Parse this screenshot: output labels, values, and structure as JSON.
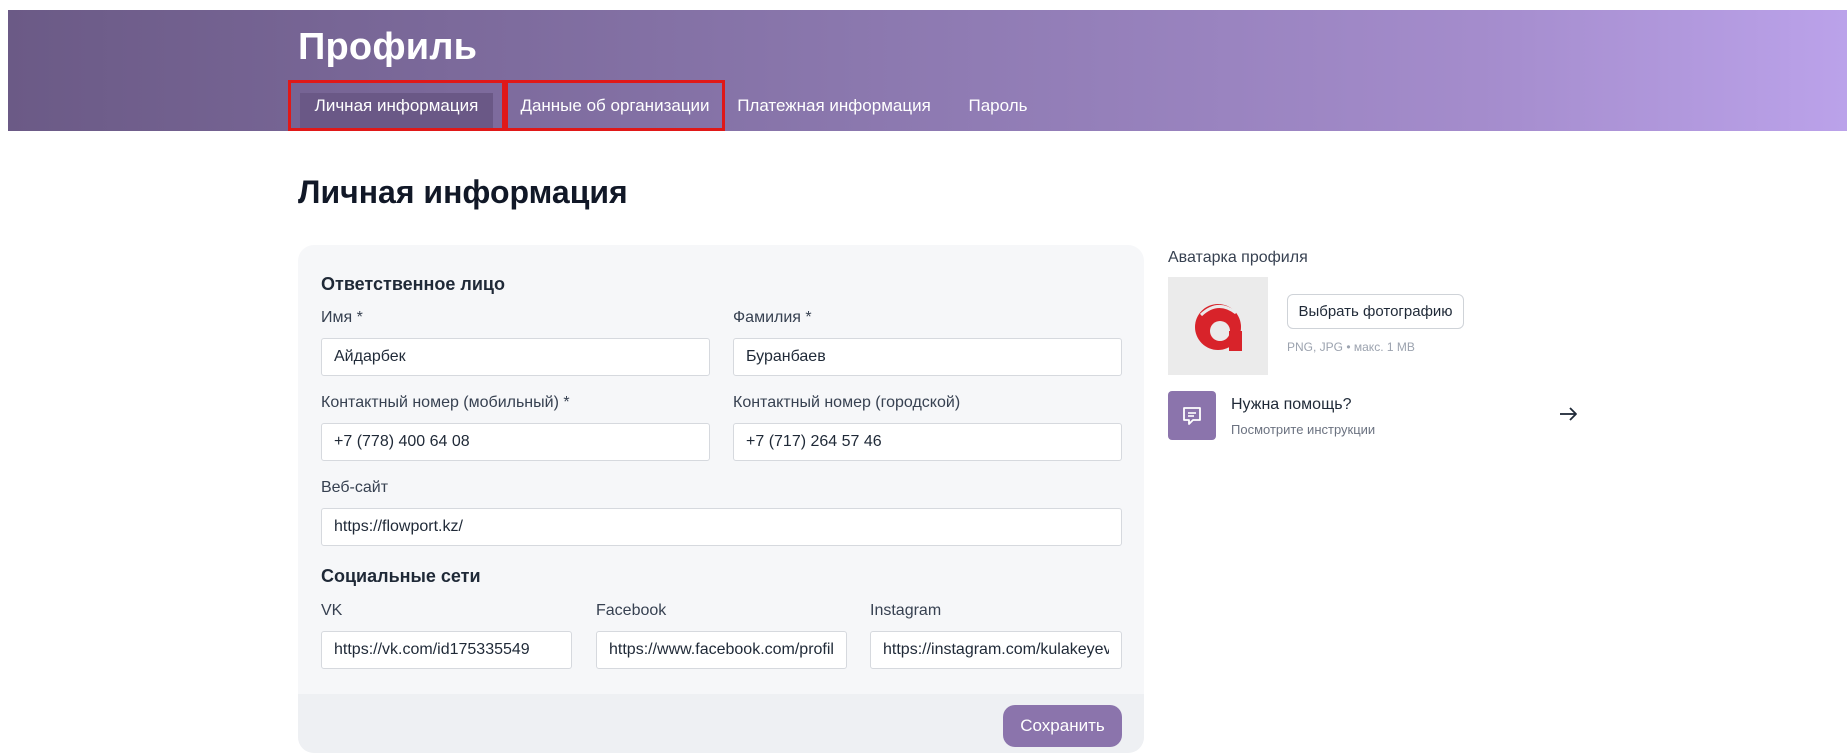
{
  "header": {
    "title": "Профиль",
    "tabs": [
      {
        "label": "Личная информация",
        "active": true
      },
      {
        "label": "Данные об организации",
        "active": false
      },
      {
        "label": "Платежная информация",
        "active": false
      },
      {
        "label": "Пароль",
        "active": false
      }
    ]
  },
  "main": {
    "section_title": "Личная информация",
    "responsible": {
      "title": "Ответственное лицо",
      "first_name": {
        "label": "Имя *",
        "value": "Айдарбек"
      },
      "last_name": {
        "label": "Фамилия *",
        "value": "Буранбаев"
      },
      "mobile": {
        "label": "Контактный номер (мобильный) *",
        "value": "+7 (778) 400 64 08"
      },
      "landline": {
        "label": "Контактный номер (городской)",
        "value": "+7 (717) 264 57 46"
      },
      "website": {
        "label": "Веб-сайт",
        "value": "https://flowport.kz/"
      }
    },
    "social": {
      "title": "Социальные сети",
      "vk": {
        "label": "VK",
        "value": "https://vk.com/id175335549"
      },
      "facebook": {
        "label": "Facebook",
        "value": "https://www.facebook.com/profile"
      },
      "instagram": {
        "label": "Instagram",
        "value": "https://instagram.com/kulakeyev"
      }
    },
    "save_label": "Сохранить"
  },
  "sidebar": {
    "avatar_label": "Аватарка профиля",
    "choose_photo_label": "Выбрать фотографию",
    "hint": "PNG, JPG • макс. 1 MB",
    "help_title": "Нужна помощь?",
    "help_subtitle": "Посмотрите инструкции"
  },
  "colors": {
    "accent": "#8b74ac",
    "logo_red": "#d8232a",
    "highlight": "#e01818"
  },
  "icons": [
    "logo-icon",
    "chat-icon",
    "arrow-right-icon"
  ]
}
